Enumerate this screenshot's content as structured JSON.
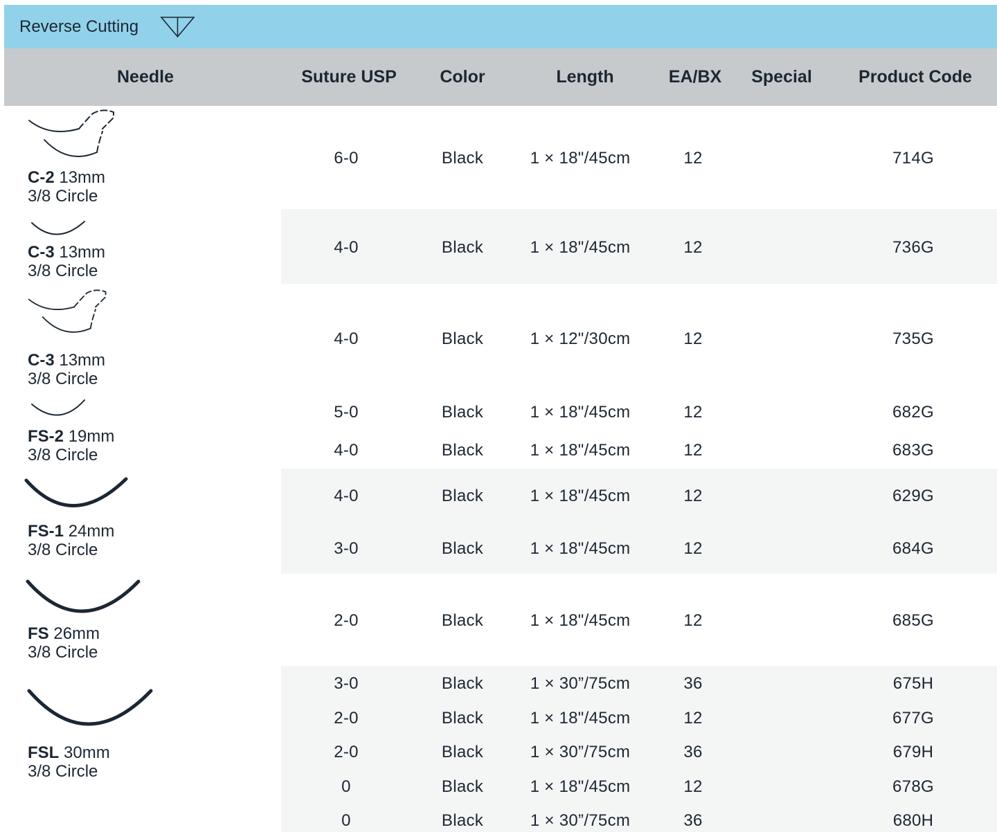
{
  "banner": {
    "title": "Reverse Cutting",
    "icon": "reverse-cutting-triangle-icon",
    "color": "#91d2ea"
  },
  "table": {
    "header_color": "#c7cacc",
    "stripe_color": "#f4f5f5",
    "headers": {
      "needle": "Needle",
      "suture_usp": "Suture USP",
      "color": "Color",
      "length": "Length",
      "ea_bx": "EA/BX",
      "special": "Special",
      "product_code": "Product Code"
    },
    "groups": [
      {
        "needle_code": "C-2",
        "needle_size": "13mm",
        "needle_shape": "3/8 Circle",
        "icon": "double-arm-needle-icon",
        "rows": [
          {
            "usp": "6-0",
            "color": "Black",
            "length": "1 × 18\"/45cm",
            "ea_bx": "12",
            "special": "",
            "code": "714G"
          }
        ]
      },
      {
        "needle_code": "C-3",
        "needle_size": "13mm",
        "needle_shape": "3/8 Circle",
        "icon": "single-needle-icon",
        "rows": [
          {
            "usp": "4-0",
            "color": "Black",
            "length": "1 × 18\"/45cm",
            "ea_bx": "12",
            "special": "",
            "code": "736G"
          }
        ]
      },
      {
        "needle_code": "C-3",
        "needle_size": "13mm",
        "needle_shape": "3/8 Circle",
        "icon": "double-arm-needle-icon",
        "rows": [
          {
            "usp": "4-0",
            "color": "Black",
            "length": "1 × 12\"/30cm",
            "ea_bx": "12",
            "special": "",
            "code": "735G"
          }
        ]
      },
      {
        "needle_code": "FS-2",
        "needle_size": "19mm",
        "needle_shape": "3/8 Circle",
        "icon": "single-needle-icon",
        "rows": [
          {
            "usp": "5-0",
            "color": "Black",
            "length": "1 × 18\"/45cm",
            "ea_bx": "12",
            "special": "",
            "code": "682G"
          },
          {
            "usp": "4-0",
            "color": "Black",
            "length": "1 × 18\"/45cm",
            "ea_bx": "12",
            "special": "",
            "code": "683G"
          }
        ]
      },
      {
        "needle_code": "FS-1",
        "needle_size": "24mm",
        "needle_shape": "3/8 Circle",
        "icon": "single-needle-icon",
        "rows": [
          {
            "usp": "4-0",
            "color": "Black",
            "length": "1 × 18\"/45cm",
            "ea_bx": "12",
            "special": "",
            "code": "629G"
          },
          {
            "usp": "3-0",
            "color": "Black",
            "length": "1 × 18\"/45cm",
            "ea_bx": "12",
            "special": "",
            "code": "684G"
          }
        ]
      },
      {
        "needle_code": "FS",
        "needle_size": "26mm",
        "needle_shape": "3/8 Circle",
        "icon": "single-needle-icon",
        "rows": [
          {
            "usp": "2-0",
            "color": "Black",
            "length": "1 × 18\"/45cm",
            "ea_bx": "12",
            "special": "",
            "code": "685G"
          }
        ]
      },
      {
        "needle_code": "FSL",
        "needle_size": "30mm",
        "needle_shape": "3/8 Circle",
        "icon": "single-needle-icon",
        "rows": [
          {
            "usp": "3-0",
            "color": "Black",
            "length": "1 × 30”/75cm",
            "ea_bx": "36",
            "special": "",
            "code": "675H"
          },
          {
            "usp": "2-0",
            "color": "Black",
            "length": "1 × 18\"/45cm",
            "ea_bx": "12",
            "special": "",
            "code": "677G"
          },
          {
            "usp": "2-0",
            "color": "Black",
            "length": "1 × 30”/75cm",
            "ea_bx": "36",
            "special": "",
            "code": "679H"
          },
          {
            "usp": "0",
            "color": "Black",
            "length": "1 × 18\"/45cm",
            "ea_bx": "12",
            "special": "",
            "code": "678G"
          },
          {
            "usp": "0",
            "color": "Black",
            "length": "1 × 30”/75cm",
            "ea_bx": "36",
            "special": "",
            "code": "680H"
          }
        ]
      }
    ]
  }
}
